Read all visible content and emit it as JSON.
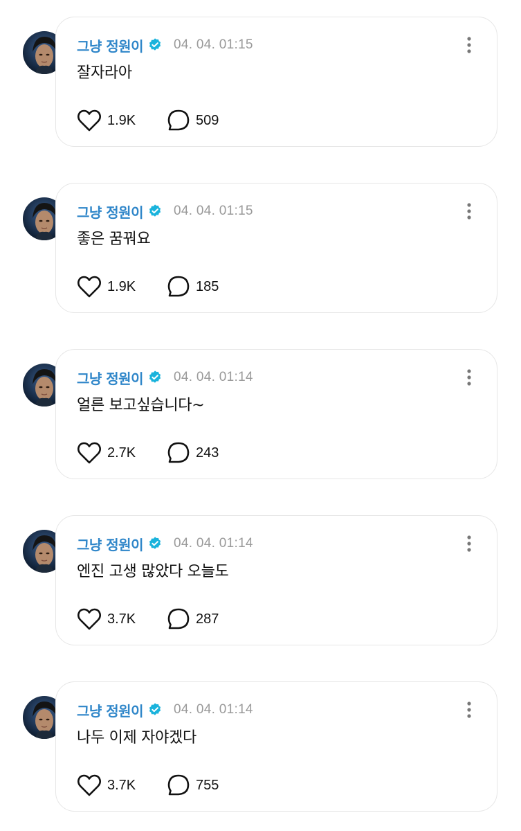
{
  "colors": {
    "name": "#2f86c9",
    "verified": "#1ab3dc",
    "time": "#9a9a9a"
  },
  "icons": {
    "like": "heart-icon",
    "comment": "comment-bubble-icon",
    "more": "more-vertical-icon",
    "verified": "verified-badge-icon"
  },
  "posts": [
    {
      "author": "그냥 정원이",
      "time": "04. 04. 01:15",
      "text": "잘자라아",
      "likes": "1.9K",
      "comments": "509"
    },
    {
      "author": "그냥 정원이",
      "time": "04. 04. 01:15",
      "text": "좋은 꿈꿔요",
      "likes": "1.9K",
      "comments": "185"
    },
    {
      "author": "그냥 정원이",
      "time": "04. 04. 01:14",
      "text": "얼른 보고싶습니다~",
      "likes": "2.7K",
      "comments": "243"
    },
    {
      "author": "그냥 정원이",
      "time": "04. 04. 01:14",
      "text": "엔진 고생 많았다 오늘도",
      "likes": "3.7K",
      "comments": "287"
    },
    {
      "author": "그냥 정원이",
      "time": "04. 04. 01:14",
      "text": "나두 이제 자야겠다",
      "likes": "3.7K",
      "comments": "755"
    }
  ]
}
